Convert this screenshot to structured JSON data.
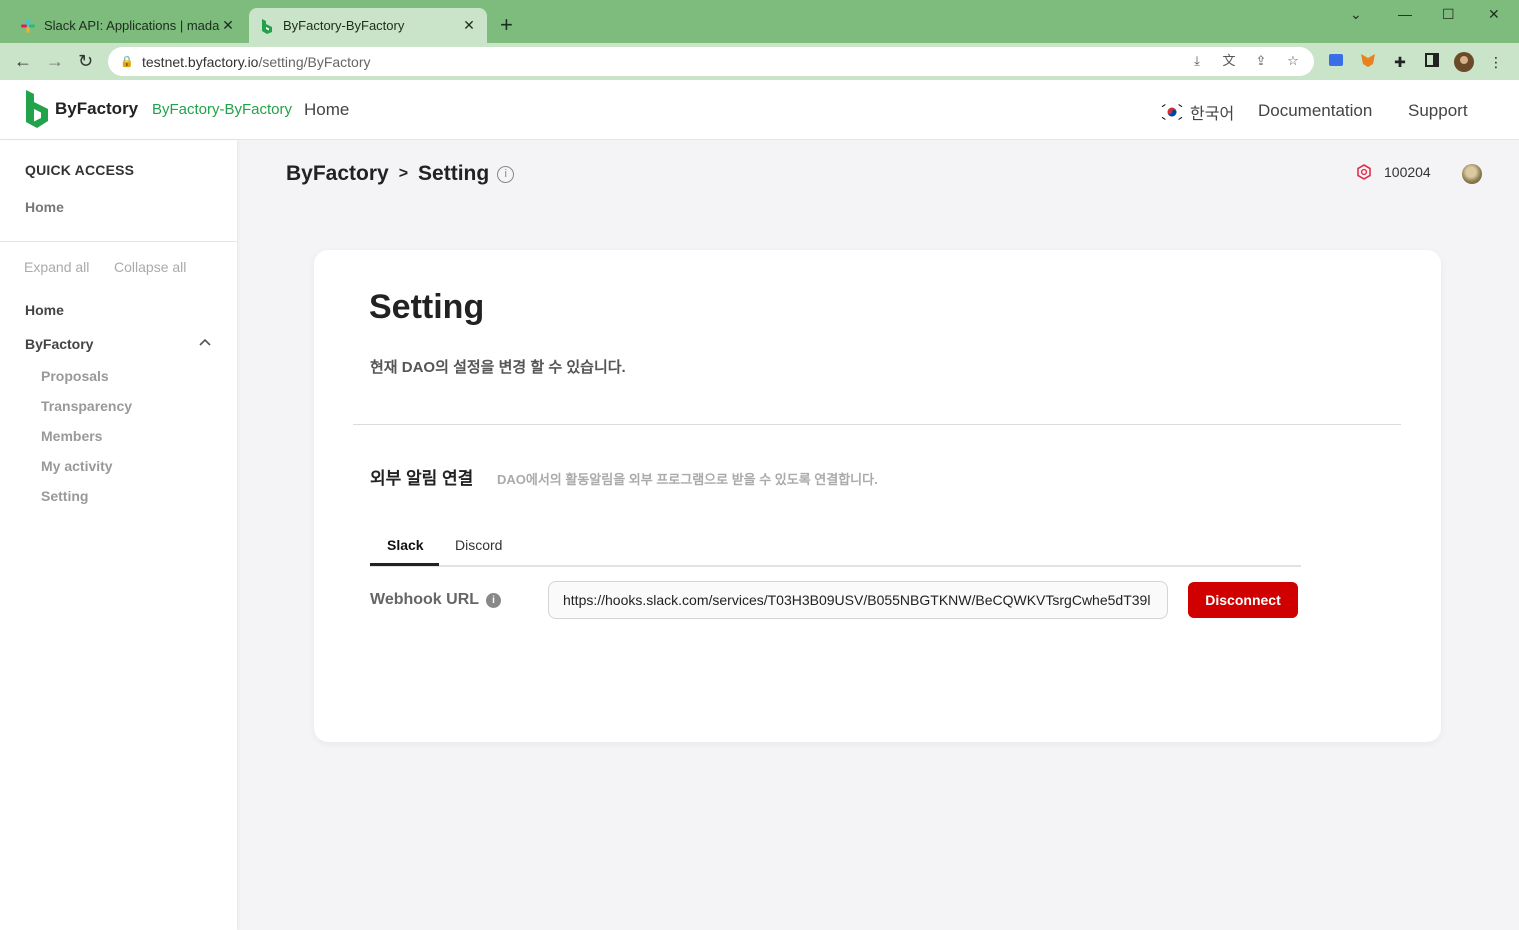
{
  "browser": {
    "tabs": [
      {
        "title": "Slack API: Applications | madapp",
        "active": false
      },
      {
        "title": "ByFactory-ByFactory",
        "active": true
      }
    ],
    "new_tab": "+",
    "url_host": "testnet.byfactory.io",
    "url_path": "/setting/ByFactory"
  },
  "header": {
    "logo_text": "ByFactory",
    "dao_name": "ByFactory-ByFactory",
    "home_link": "Home",
    "language": "한국어",
    "documentation": "Documentation",
    "support": "Support",
    "brand_color": "#22a24a"
  },
  "sidebar": {
    "quick_access": "QUICK ACCESS",
    "quick_home": "Home",
    "expand_all": "Expand all",
    "collapse_all": "Collapse all",
    "home": "Home",
    "group": "ByFactory",
    "sub_items": [
      "Proposals",
      "Transparency",
      "Members",
      "My activity",
      "Setting"
    ]
  },
  "breadcrumb": {
    "root": "ByFactory",
    "sep": ">",
    "current": "Setting",
    "info": "i"
  },
  "token": {
    "balance": "100204"
  },
  "card": {
    "title": "Setting",
    "subtitle": "현재 DAO의 설정을 변경 할 수 있습니다.",
    "section_title": "외부 알림 연결",
    "section_desc": "DAO에서의 활동알림을 외부 프로그램으로 받을 수 있도록 연결합니다.",
    "tabs": [
      "Slack",
      "Discord"
    ],
    "active_tab": "Slack",
    "webhook_label": "Webhook URL",
    "webhook_info": "i",
    "webhook_value": "https://hooks.slack.com/services/T03H3B09USV/B055NBGTKNW/BeCQWKVTsrgCwhe5dT39l",
    "disconnect_label": "Disconnect",
    "disconnect_color": "#d10000"
  }
}
